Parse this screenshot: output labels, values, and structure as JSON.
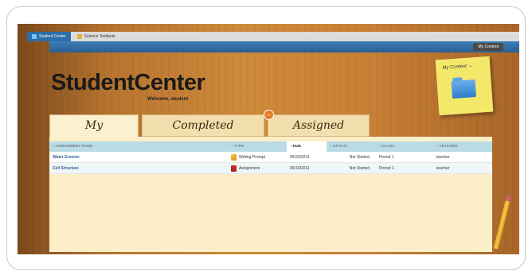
{
  "browser_tabs": [
    {
      "label": "Student Center",
      "active": true
    },
    {
      "label": "Science Textbook",
      "active": false
    }
  ],
  "header": {
    "my_content_button": "My Content"
  },
  "brand": {
    "title": "StudentCenter",
    "welcome": "Welcome, student"
  },
  "sticky_note": {
    "label": "My Content →",
    "icon": "folder-icon"
  },
  "assignment_tabs": [
    {
      "label": "My Assignments",
      "active": true
    },
    {
      "label": "Completed Assignments",
      "active": false
    },
    {
      "label": "Assigned Resources",
      "active": false,
      "badge": "−"
    }
  ],
  "table": {
    "columns": [
      "↕ ASSIGNMENT NAME",
      "↕ TYPE",
      "↕ DUE",
      "↕ STATUS",
      "↕ CLASS",
      "↕ TEACHER"
    ],
    "rows": [
      {
        "name": "Water Erosion",
        "type": "Writing Prompt",
        "type_icon": "writing-prompt-icon",
        "due": "05/23/2011",
        "status": "Not Started",
        "class": "Period 1",
        "teacher": "teacher"
      },
      {
        "name": "Cell Structure",
        "type": "Assignment",
        "type_icon": "assignment-icon",
        "due": "05/19/2011",
        "status": "Not Started",
        "class": "Period 1",
        "teacher": "teacher"
      }
    ]
  },
  "colors": {
    "accent_blue": "#2c6fa8",
    "link": "#2f5f96",
    "tab_bg": "#f3deae",
    "panel_bg": "#fbeec9",
    "table_header": "#b9dbe6"
  }
}
